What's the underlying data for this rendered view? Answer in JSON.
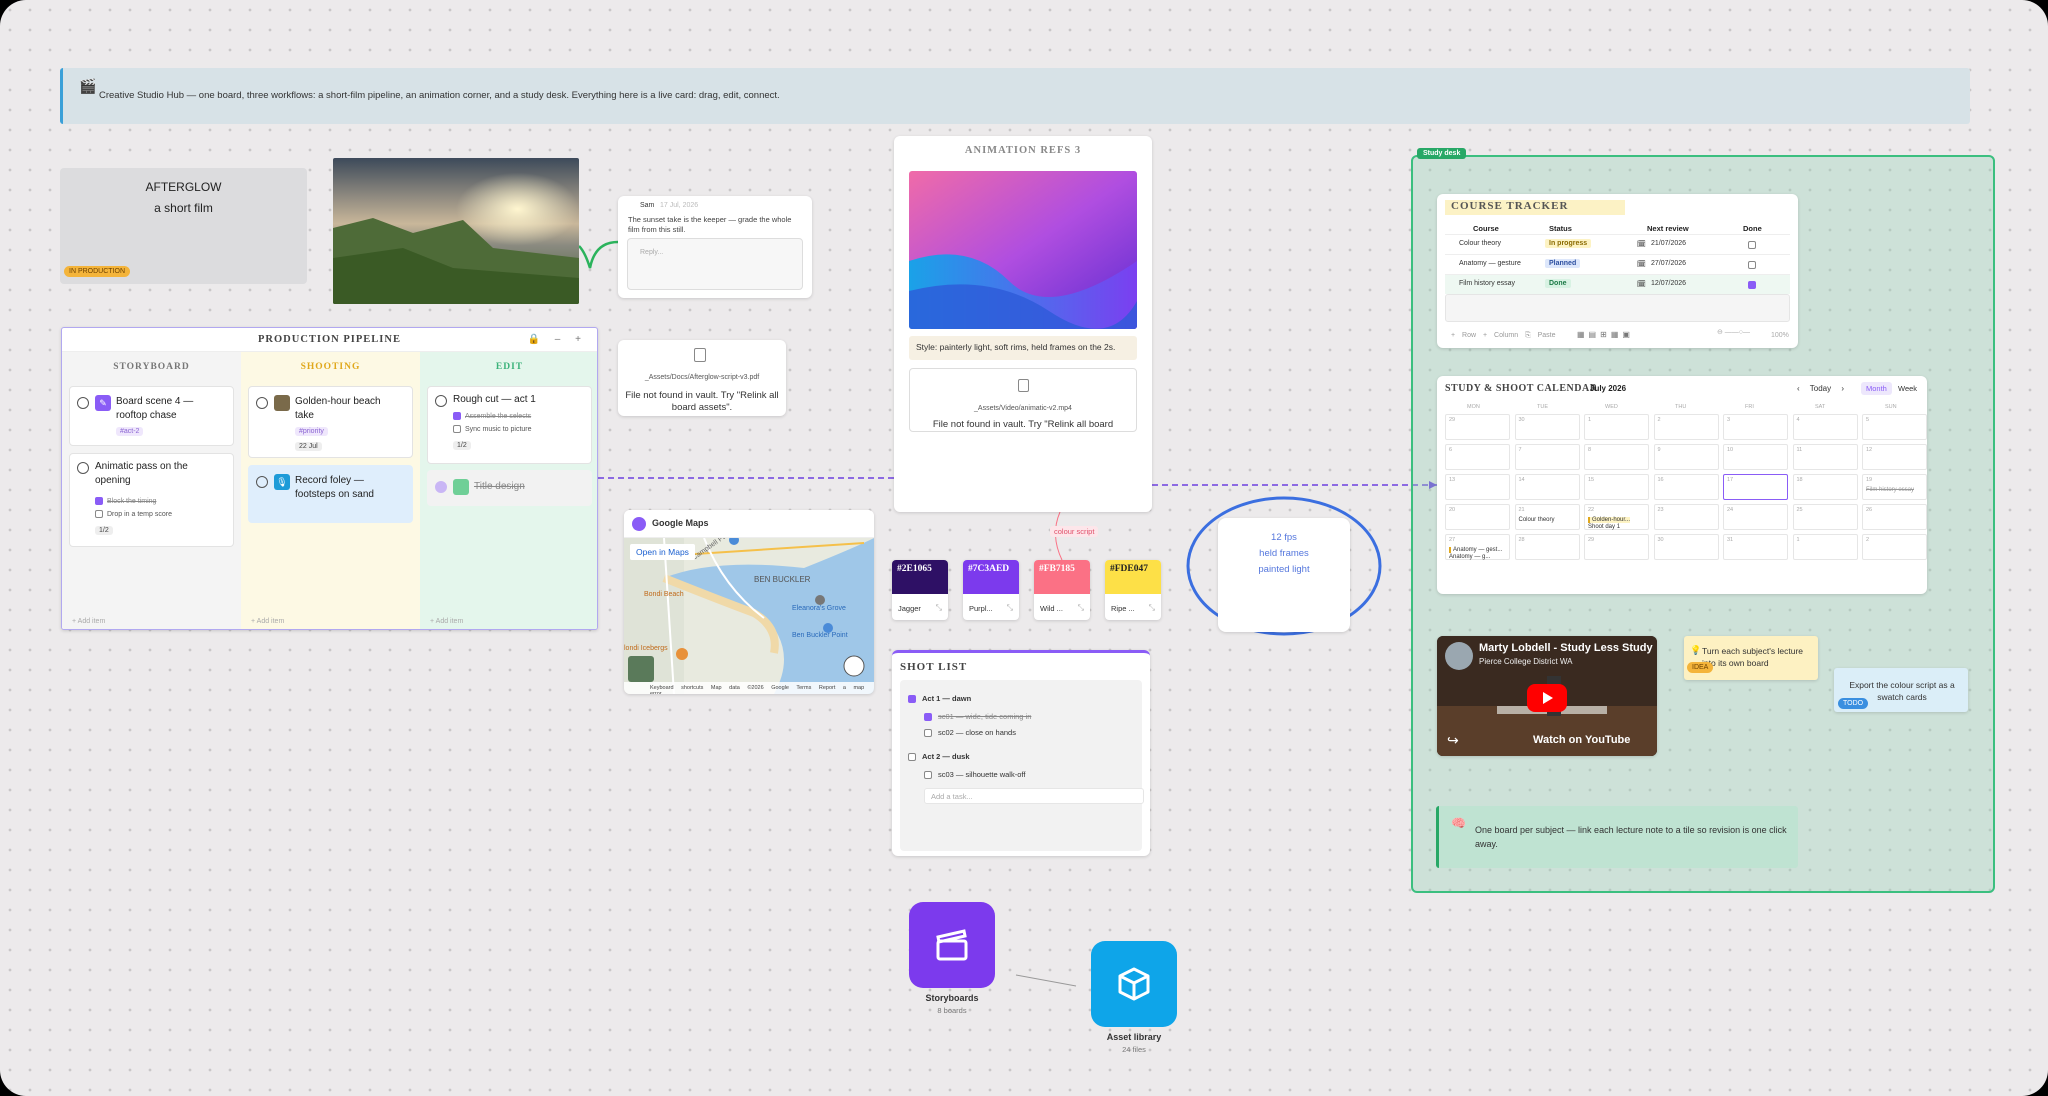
{
  "banner": {
    "icon": "clapperboard-icon",
    "text": "Creative Studio Hub — one board, three workflows: a short-film pipeline, an animation corner, and a study desk. Everything here is a live card: drag, edit, connect."
  },
  "film": {
    "title": "AFTERGLOW",
    "subtitle": "a short film",
    "badge": "IN PRODUCTION"
  },
  "comment": {
    "author": "Sam",
    "date": "17 Jul, 2026",
    "body": "The sunset take is the keeper — grade the whole film from this still.",
    "reply_placeholder": "Reply..."
  },
  "pipeline": {
    "title": "PRODUCTION PIPELINE",
    "controls": "🔒 – +",
    "add_item": "+ Add item",
    "columns": [
      {
        "name": "STORYBOARD",
        "color": "#777777"
      },
      {
        "name": "SHOOTING",
        "color": "#e0a81c"
      },
      {
        "name": "EDIT",
        "color": "#3bb27a"
      }
    ],
    "storyboard": [
      {
        "title": "Board scene 4 — rooftop chase",
        "tag": "#act-2"
      },
      {
        "title": "Animatic pass on the opening",
        "sub1": "Block the timing",
        "sub2": "Drop in a temp score",
        "count": "1/2"
      }
    ],
    "shooting": [
      {
        "title": "Golden-hour beach take",
        "tag": "#priority",
        "date": "22 Jul"
      },
      {
        "title": "Record foley — footsteps on sand"
      }
    ],
    "edit": [
      {
        "title": "Rough cut — act 1",
        "sub1": "Assemble the selects",
        "sub2": "Sync music to picture",
        "count": "1/2"
      },
      {
        "title": "Title design"
      }
    ]
  },
  "script_file": {
    "path": "_Assets/Docs/Afterglow-script-v3.pdf",
    "message": "File not found in vault. Try \"Relink all board assets\"."
  },
  "animation": {
    "title": "ANIMATION REFS 3",
    "caption": "Style: painterly light, soft rims, held frames on the 2s.",
    "video_path": "_Assets/Video/animatic-v2.mp4",
    "video_msg": "File not found in vault. Try \"Relink all board"
  },
  "map": {
    "title": "Google Maps",
    "open": "Open in Maps",
    "labels": [
      "Bondi Markets",
      "Campbell Parade",
      "BEN BUCKLER",
      "Bondi Beach",
      "Eleanora's Grove Breathwork &...",
      "Ben Buckler Point",
      "Bondi Icebergs CLUB"
    ],
    "footer": "Keyboard shortcuts   Map data ©2026 Google   Terms   Report a map error",
    "google": "Google"
  },
  "connector_label": "colour script",
  "swatches": [
    {
      "hex": "#2E1065",
      "name": "Jagger",
      "color": "#2e1065",
      "fg": "#ffffff"
    },
    {
      "hex": "#7C3AED",
      "name": "Purpl...",
      "color": "#7c3aed",
      "fg": "#ffffff"
    },
    {
      "hex": "#FB7185",
      "name": "Wild ...",
      "color": "#fb7185",
      "fg": "#ffffff"
    },
    {
      "hex": "#FDE047",
      "name": "Ripe ...",
      "color": "#fde047",
      "fg": "#222222"
    }
  ],
  "note": {
    "l1": "12 fps",
    "l2": "held frames",
    "l3": "painted light"
  },
  "shot_list": {
    "title": "SHOT LIST",
    "act1": "Act 1 — dawn",
    "s1": "sc01 — wide, tide coming in",
    "s2": "sc02 — close on hands",
    "act2": "Act 2 — dusk",
    "s3": "sc03 — silhouette walk-off",
    "add": "Add a task..."
  },
  "apps": [
    {
      "name": "Storyboards",
      "sub": "8 boards",
      "color": "#7c3aed"
    },
    {
      "name": "Asset library",
      "sub": "24 files",
      "color": "#0ea5e9"
    }
  ],
  "study": {
    "label": "Study desk"
  },
  "tracker": {
    "title": "COURSE TRACKER",
    "headers": [
      "Course",
      "Status",
      "Next review",
      "Done"
    ],
    "rows": [
      {
        "course": "Colour theory",
        "status": "In progress",
        "date": "21/07/2026",
        "done": false,
        "bg": "#fdf3c4",
        "fg": "#8a6a00"
      },
      {
        "course": "Anatomy — gesture",
        "status": "Planned",
        "date": "27/07/2026",
        "done": false,
        "bg": "#dde7fb",
        "fg": "#2d4fa0"
      },
      {
        "course": "Film history essay",
        "status": "Done",
        "date": "12/07/2026",
        "done": true,
        "bg": "#d8f2e3",
        "fg": "#1d7a47"
      }
    ],
    "toolbar": "+ Row  + Column  ⎘ Paste",
    "zoom": "100%"
  },
  "calendar": {
    "title": "STUDY & SHOOT CALENDAR",
    "month": "July 2026",
    "nav": "‹ Today ›",
    "month_btn": "Month",
    "week_btn": "Week",
    "days": [
      "MON",
      "TUE",
      "WED",
      "THU",
      "FRI",
      "SAT",
      "SUN"
    ],
    "events": {
      "ev1": "Film history essay",
      "ev2": "Colour theory",
      "ev3": "Golden-hour...",
      "ev4": "Shoot day 1",
      "ev5": "Anatomy — gest...",
      "ev6": "Anatomy — g..."
    }
  },
  "youtube": {
    "title": "Marty Lobdell - Study Less Study",
    "channel": "Pierce College District WA",
    "watch": "Watch on",
    "brand": "YouTube"
  },
  "idea": {
    "text": "Turn each subject's lecture into its own board",
    "badge": "IDEA"
  },
  "todo": {
    "text": "Export the colour script as a swatch cards",
    "badge": "TODO"
  },
  "callout": {
    "text": "One board per subject — link each lecture note to a tile so revision is one click away."
  }
}
